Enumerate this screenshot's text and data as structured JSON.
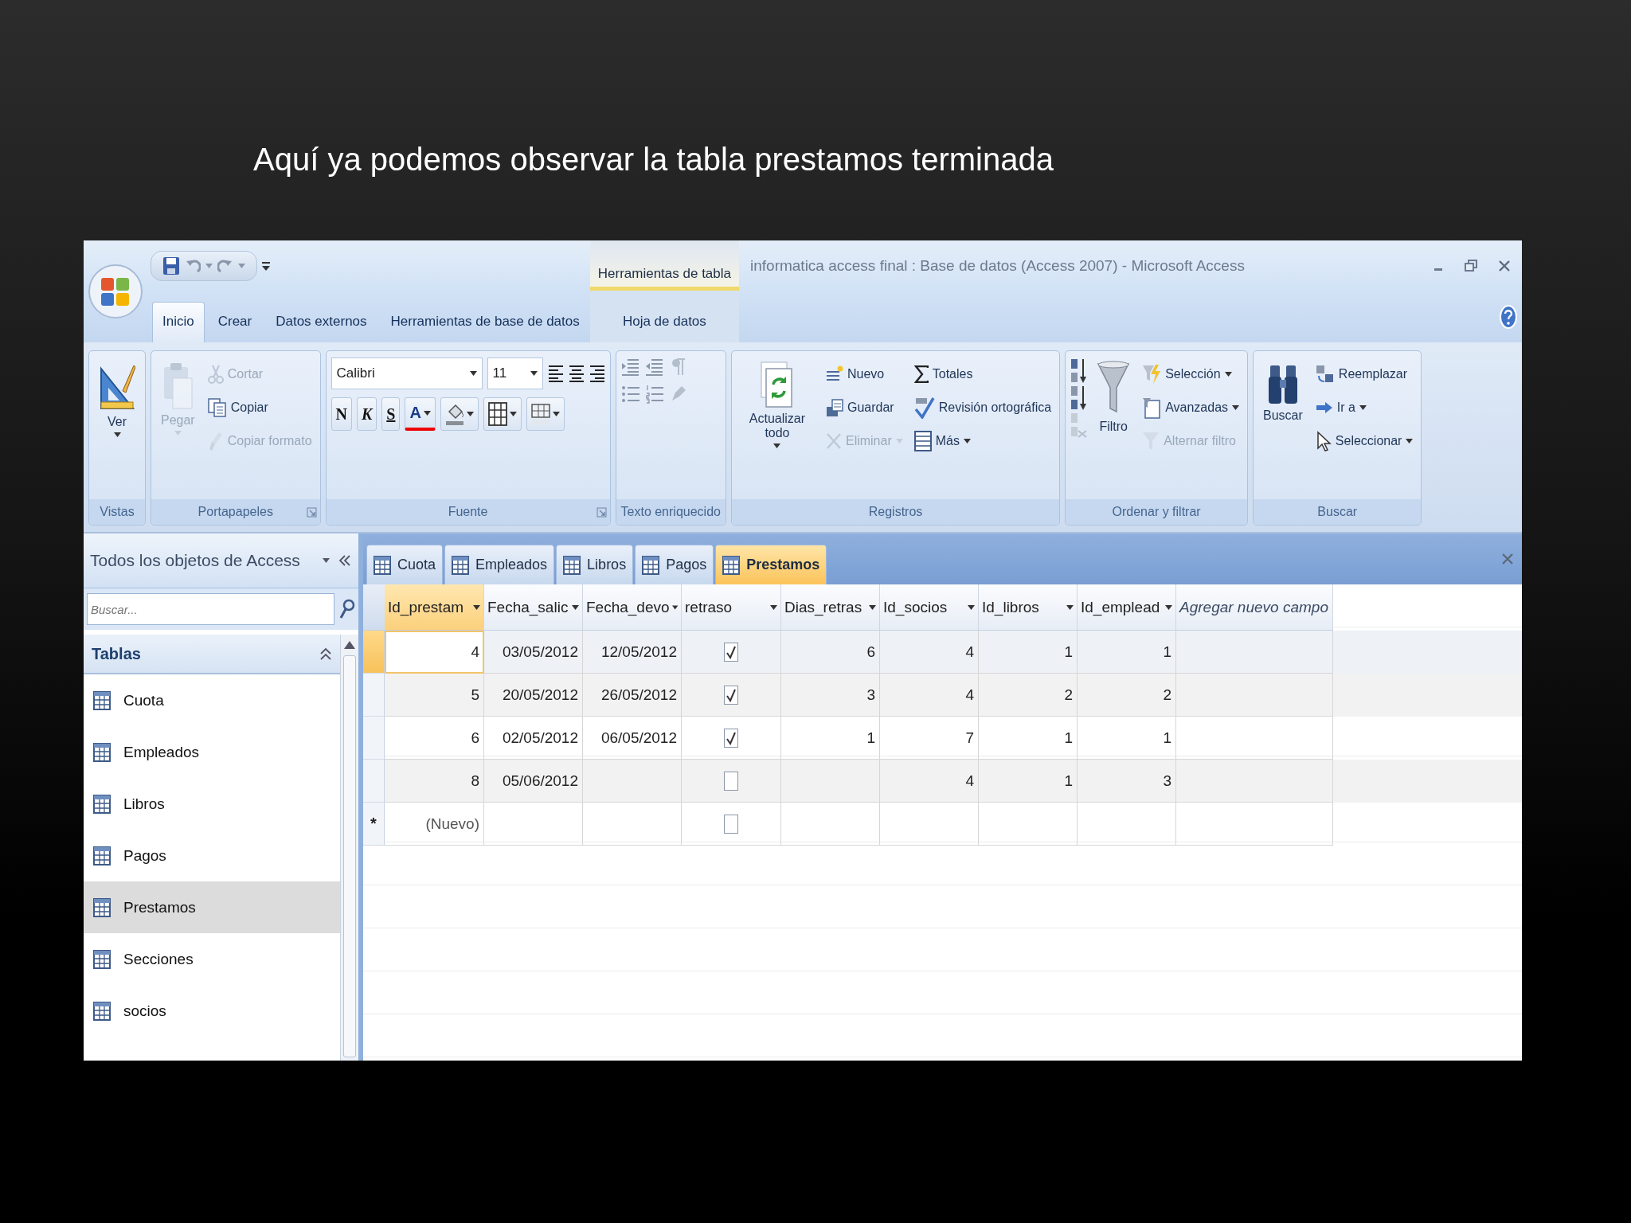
{
  "slide": {
    "caption": "Aquí ya podemos observar la tabla prestamos terminada"
  },
  "window": {
    "title": "informatica access final : Base de datos (Access 2007) - Microsoft Access",
    "context_header": "Herramientas de tabla"
  },
  "ribbon_tabs": [
    {
      "label": "Inicio",
      "selected": true,
      "kind": "main"
    },
    {
      "label": "Crear",
      "selected": false,
      "kind": "main"
    },
    {
      "label": "Datos externos",
      "selected": false,
      "kind": "main"
    },
    {
      "label": "Herramientas de base de datos",
      "selected": false,
      "kind": "main"
    },
    {
      "label": "Hoja de datos",
      "selected": false,
      "kind": "context"
    }
  ],
  "ribbon_groups": [
    {
      "kind": "views",
      "title": "Vistas",
      "launcher": false,
      "items": [
        {
          "label": "Ver",
          "dropdown": true,
          "disabled": false
        }
      ]
    },
    {
      "kind": "clipboard",
      "title": "Portapapeles",
      "launcher": true,
      "items": [
        {
          "label": "Pegar",
          "dropdown": true,
          "disabled": true
        },
        {
          "label": "Cortar",
          "dropdown": false,
          "disabled": true
        },
        {
          "label": "Copiar",
          "dropdown": false,
          "disabled": false
        },
        {
          "label": "Copiar formato",
          "dropdown": false,
          "disabled": true
        }
      ]
    },
    {
      "kind": "font",
      "title": "Fuente",
      "launcher": true,
      "font": "Calibri",
      "size": "11",
      "format_buttons": [
        {
          "label": "N",
          "kind": "bold"
        },
        {
          "label": "K",
          "kind": "italic"
        },
        {
          "label": "S",
          "kind": "underline"
        },
        {
          "label": "A",
          "kind": "color"
        }
      ]
    },
    {
      "kind": "rich_text",
      "title": "Texto enriquecido",
      "launcher": false
    },
    {
      "kind": "records",
      "title": "Registros",
      "launcher": false,
      "items": [
        {
          "label": "Actualizar todo",
          "dropdown": true,
          "disabled": false
        },
        {
          "label": "Nuevo",
          "dropdown": false,
          "disabled": false
        },
        {
          "label": "Guardar",
          "dropdown": false,
          "disabled": false
        },
        {
          "label": "Eliminar",
          "dropdown": true,
          "disabled": true
        },
        {
          "label": "Totales",
          "dropdown": false,
          "disabled": false
        },
        {
          "label": "Revisión ortográfica",
          "dropdown": false,
          "disabled": false
        },
        {
          "label": "Más",
          "dropdown": true,
          "disabled": false
        }
      ]
    },
    {
      "kind": "sort_filter",
      "title": "Ordenar y filtrar",
      "launcher": false,
      "items": [
        {
          "label": "Filtro",
          "dropdown": false,
          "disabled": false
        },
        {
          "label": "Selección",
          "dropdown": true,
          "disabled": false
        },
        {
          "label": "Avanzadas",
          "dropdown": true,
          "disabled": false
        },
        {
          "label": "Alternar filtro",
          "dropdown": false,
          "disabled": true
        }
      ]
    },
    {
      "kind": "find",
      "title": "Buscar",
      "launcher": false,
      "items": [
        {
          "label": "Buscar",
          "dropdown": false,
          "disabled": false
        },
        {
          "label": "Reemplazar",
          "dropdown": false,
          "disabled": false
        },
        {
          "label": "Ir a",
          "dropdown": true,
          "disabled": false
        },
        {
          "label": "Seleccionar",
          "dropdown": true,
          "disabled": false
        }
      ]
    }
  ],
  "nav": {
    "title": "Todos los objetos de Access",
    "search_placeholder": "Buscar...",
    "section": {
      "title": "Tablas",
      "expanded": true,
      "items": [
        {
          "label": "Cuota",
          "selected": false
        },
        {
          "label": "Empleados",
          "selected": false
        },
        {
          "label": "Libros",
          "selected": false
        },
        {
          "label": "Pagos",
          "selected": false
        },
        {
          "label": "Prestamos",
          "selected": true
        },
        {
          "label": "Secciones",
          "selected": false
        },
        {
          "label": "socios",
          "selected": false
        }
      ]
    }
  },
  "doc_tabs": [
    {
      "label": "Cuota",
      "selected": false
    },
    {
      "label": "Empleados",
      "selected": false
    },
    {
      "label": "Libros",
      "selected": false
    },
    {
      "label": "Pagos",
      "selected": false
    },
    {
      "label": "Prestamos",
      "selected": true
    }
  ],
  "datasheet": {
    "columns": [
      {
        "label": "Id_prestam",
        "kind": "field",
        "dropdown": true,
        "selected": true
      },
      {
        "label": "Fecha_salic",
        "kind": "field",
        "dropdown": true,
        "selected": false
      },
      {
        "label": "Fecha_devo",
        "kind": "field",
        "dropdown": true,
        "selected": false
      },
      {
        "label": "retraso",
        "kind": "field",
        "dropdown": true,
        "selected": false
      },
      {
        "label": "Dias_retras",
        "kind": "field",
        "dropdown": true,
        "selected": false
      },
      {
        "label": "Id_socios",
        "kind": "field",
        "dropdown": true,
        "selected": false
      },
      {
        "label": "Id_libros",
        "kind": "field",
        "dropdown": true,
        "selected": false
      },
      {
        "label": "Id_emplead",
        "kind": "field",
        "dropdown": true,
        "selected": false
      },
      {
        "label": "Agregar nuevo campo",
        "kind": "add",
        "dropdown": false,
        "selected": false
      }
    ],
    "rows": [
      {
        "kind": "record",
        "selected": true,
        "cells": [
          {
            "kind": "text",
            "text": "4"
          },
          {
            "kind": "text",
            "text": "03/05/2012"
          },
          {
            "kind": "text",
            "text": "12/05/2012"
          },
          {
            "kind": "check",
            "checked": true
          },
          {
            "kind": "text",
            "text": "6"
          },
          {
            "kind": "text",
            "text": "4"
          },
          {
            "kind": "text",
            "text": "1"
          },
          {
            "kind": "text",
            "text": "1"
          }
        ]
      },
      {
        "kind": "record",
        "selected": false,
        "cells": [
          {
            "kind": "text",
            "text": "5"
          },
          {
            "kind": "text",
            "text": "20/05/2012"
          },
          {
            "kind": "text",
            "text": "26/05/2012"
          },
          {
            "kind": "check",
            "checked": true
          },
          {
            "kind": "text",
            "text": "3"
          },
          {
            "kind": "text",
            "text": "4"
          },
          {
            "kind": "text",
            "text": "2"
          },
          {
            "kind": "text",
            "text": "2"
          }
        ]
      },
      {
        "kind": "record",
        "selected": false,
        "cells": [
          {
            "kind": "text",
            "text": "6"
          },
          {
            "kind": "text",
            "text": "02/05/2012"
          },
          {
            "kind": "text",
            "text": "06/05/2012"
          },
          {
            "kind": "check",
            "checked": true
          },
          {
            "kind": "text",
            "text": "1"
          },
          {
            "kind": "text",
            "text": "7"
          },
          {
            "kind": "text",
            "text": "1"
          },
          {
            "kind": "text",
            "text": "1"
          }
        ]
      },
      {
        "kind": "record",
        "selected": false,
        "cells": [
          {
            "kind": "text",
            "text": "8"
          },
          {
            "kind": "text",
            "text": "05/06/2012"
          },
          {
            "kind": "blank"
          },
          {
            "kind": "check",
            "checked": false
          },
          {
            "kind": "blank"
          },
          {
            "kind": "text",
            "text": "4"
          },
          {
            "kind": "text",
            "text": "1"
          },
          {
            "kind": "text",
            "text": "3"
          }
        ]
      },
      {
        "kind": "new",
        "selected": false,
        "marker": "*",
        "cells": [
          {
            "kind": "text",
            "text": "(Nuevo)"
          },
          {
            "kind": "blank"
          },
          {
            "kind": "blank"
          },
          {
            "kind": "check",
            "checked": false
          },
          {
            "kind": "blank"
          },
          {
            "kind": "blank"
          },
          {
            "kind": "blank"
          },
          {
            "kind": "blank"
          }
        ]
      }
    ]
  }
}
